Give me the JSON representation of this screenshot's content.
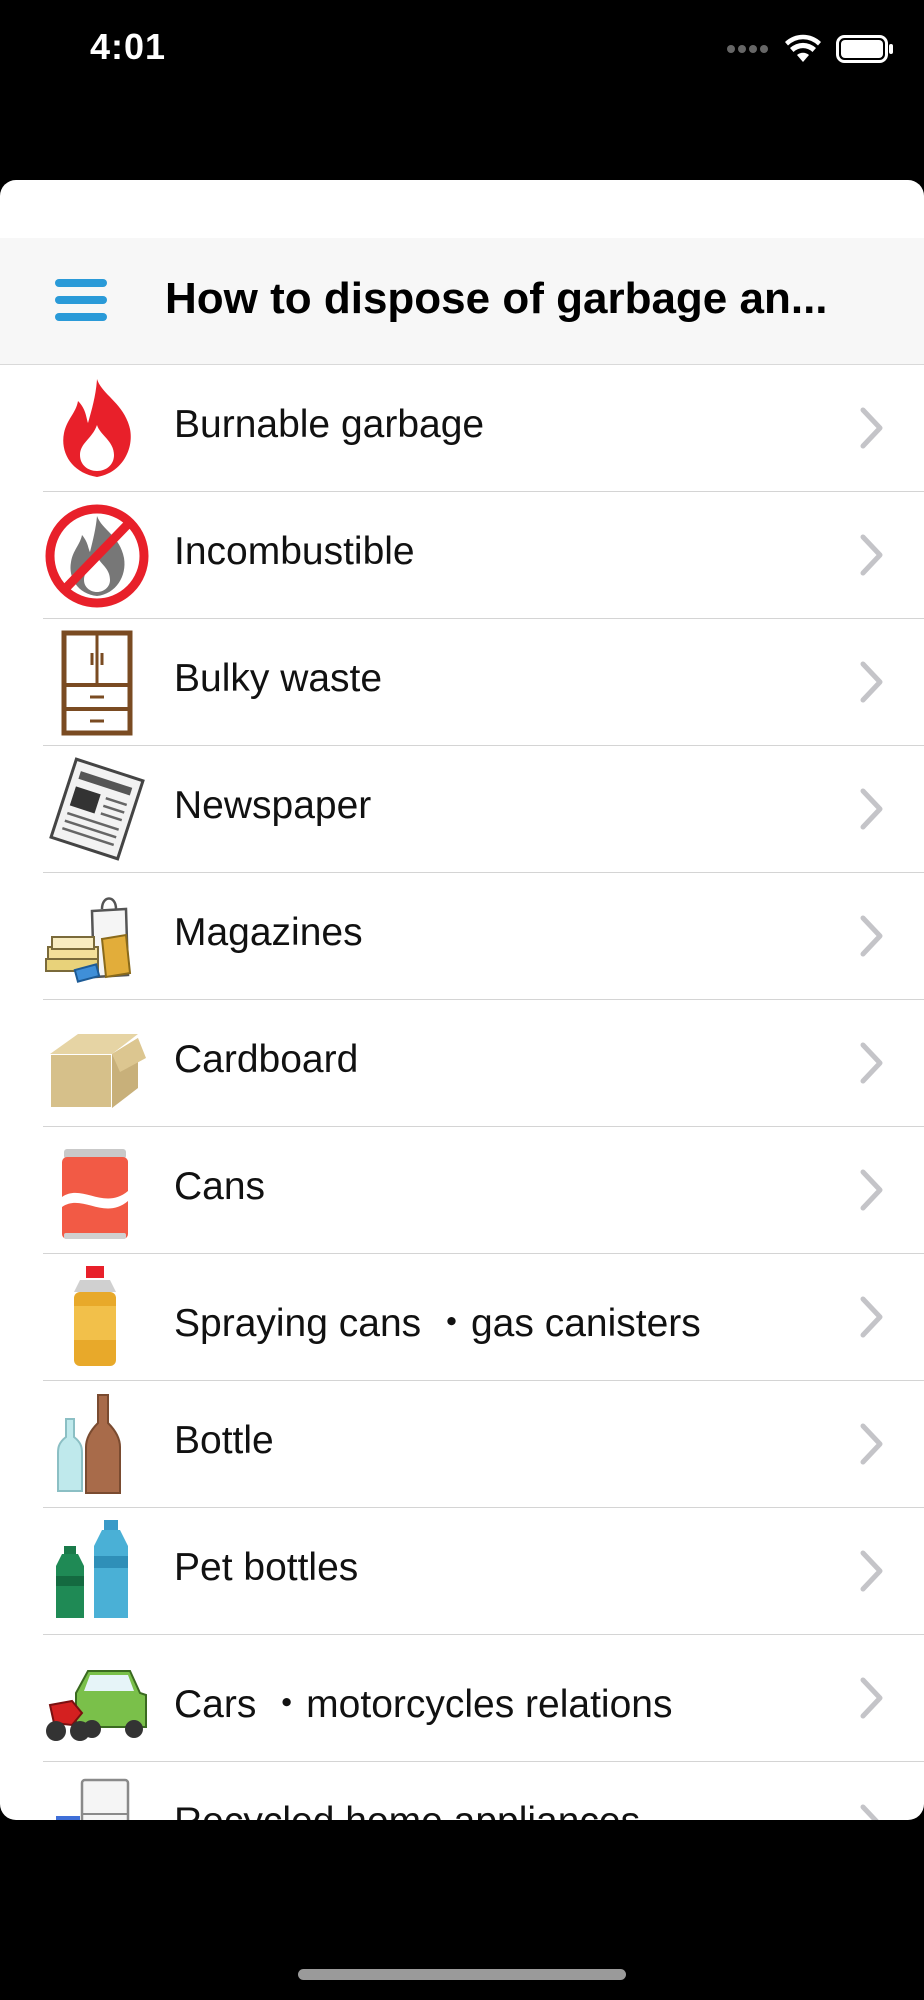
{
  "status_bar": {
    "time": "4:01"
  },
  "nav": {
    "title": "How to dispose of garbage an...",
    "menu_icon": "hamburger-menu-icon",
    "accent_color": "#2a9ad8"
  },
  "list": {
    "items": [
      {
        "label": "Burnable garbage",
        "icon": "flame-icon"
      },
      {
        "label": "Incombustible",
        "icon": "no-fire-icon"
      },
      {
        "label": "Bulky waste",
        "icon": "cabinet-icon"
      },
      {
        "label": "Newspaper",
        "icon": "newspaper-icon"
      },
      {
        "label": "Magazines",
        "icon": "magazines-icon"
      },
      {
        "label": "Cardboard",
        "icon": "cardboard-box-icon"
      },
      {
        "label": "Cans",
        "icon": "soda-can-icon"
      },
      {
        "label": "Spraying cans ・gas canisters",
        "icon": "spray-can-icon"
      },
      {
        "label": "Bottle",
        "icon": "glass-bottles-icon"
      },
      {
        "label": "Pet bottles",
        "icon": "pet-bottles-icon"
      },
      {
        "label": "Cars ・motorcycles relations",
        "icon": "car-motorcycle-icon"
      },
      {
        "label": "Recycled home appliances",
        "icon": "refrigerator-icon"
      }
    ]
  }
}
